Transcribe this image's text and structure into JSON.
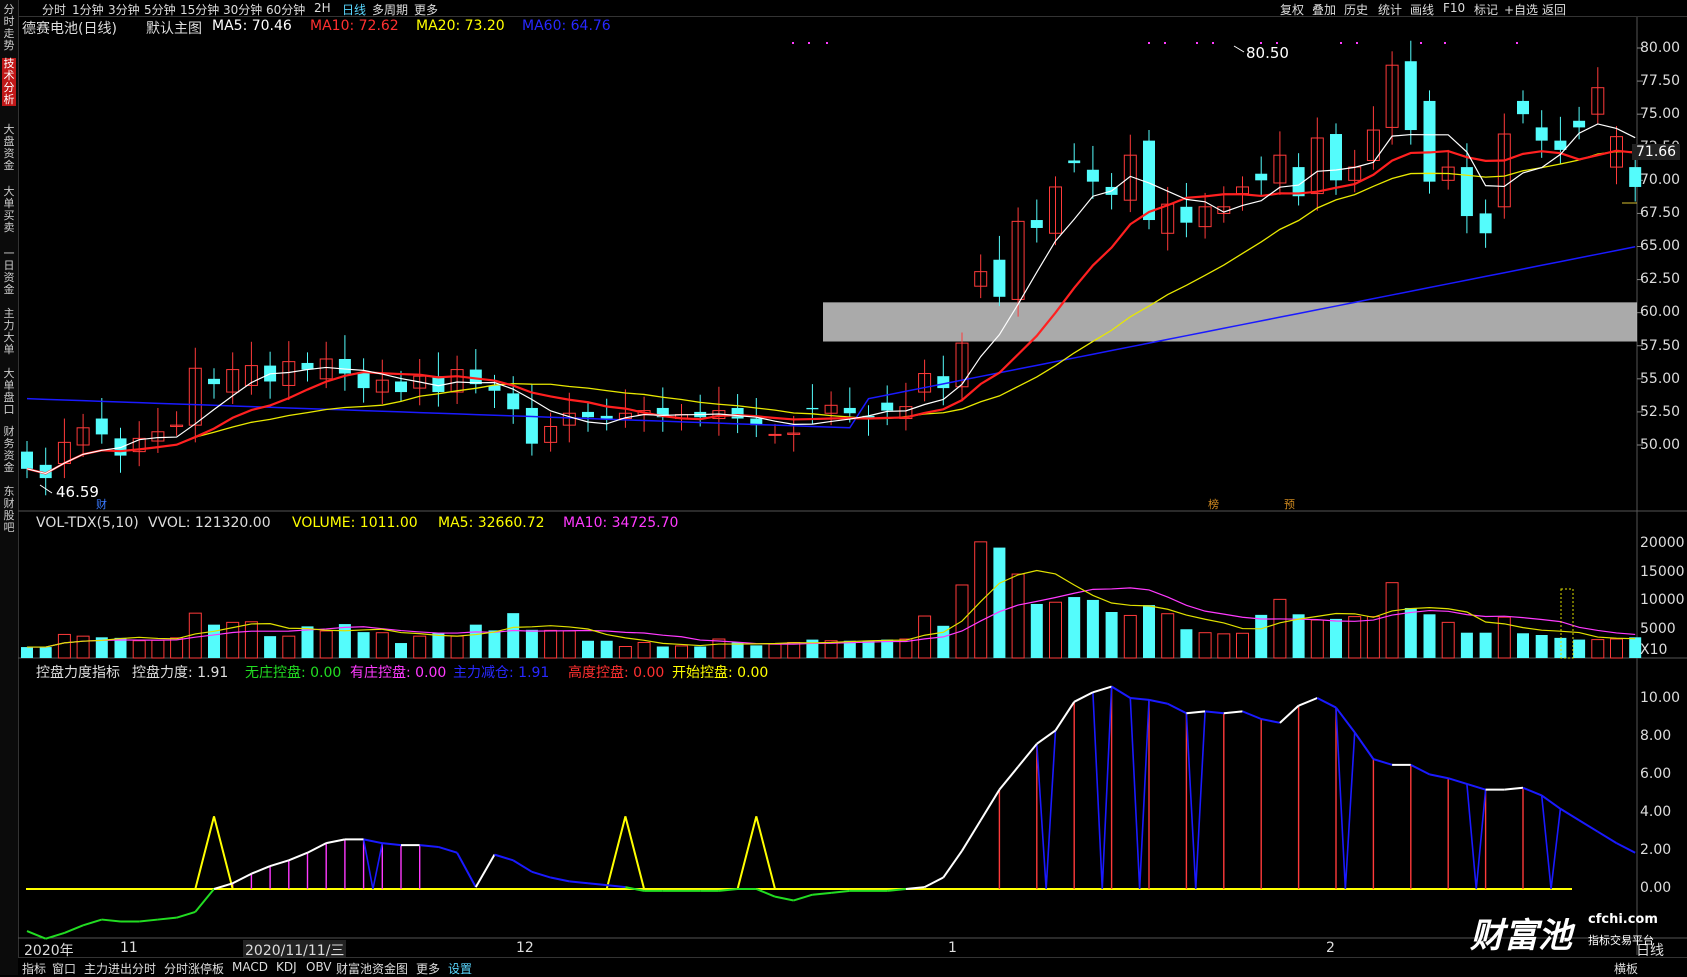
{
  "topbar": {
    "items": [
      "分时",
      "1分钟",
      "3分钟",
      "5分钟",
      "15分钟",
      "30分钟",
      "60分钟",
      "2H",
      "日线",
      "多周期",
      "更多"
    ],
    "active": "日线",
    "right": [
      "复权",
      "叠加",
      "历史",
      "统计",
      "画线",
      "F10",
      "标记",
      "+自选",
      "返回"
    ]
  },
  "sidebar": {
    "items": [
      "分时走势",
      "技术分析",
      "大盘资金",
      "大单买卖",
      "一日资金",
      "主力大单",
      "大单盘口",
      "财务资金",
      "东财股吧"
    ],
    "active": "技术分析"
  },
  "main": {
    "stock": "德赛电池(日线)",
    "template": "默认主图",
    "ma5": "MA5: 70.46",
    "ma10": "MA10: 72.62",
    "ma20": "MA20: 73.20",
    "ma60": "MA60: 64.76",
    "price_marker": "71.66",
    "high_label": "80.50",
    "low_label": "46.59",
    "zone_label": "57.82 - 60.78",
    "badges": [
      "财",
      "榜",
      "预"
    ],
    "yaxis": [
      "80.00",
      "77.50",
      "75.00",
      "72.50",
      "70.00",
      "67.50",
      "65.00",
      "62.50",
      "60.00",
      "57.50",
      "55.00",
      "52.50",
      "50.00"
    ]
  },
  "volume": {
    "name": "VOL-TDX(5,10)",
    "vvol": "VVOL: 121320.00",
    "volume": "VOLUME: 1011.00",
    "ma5": "MA5: 32660.72",
    "ma10": "MA10: 34725.70",
    "yaxis": [
      "20000",
      "15000",
      "10000",
      "5000",
      "X10"
    ]
  },
  "indicator": {
    "name": "控盘力度指标",
    "v1": "控盘力度: 1.91",
    "v2": "无庄控盘: 0.00",
    "v3": "有庄控盘: 0.00",
    "v4": "主力减仓: 1.91",
    "v5": "高度控盘: 0.00",
    "v6": "开始控盘: 0.00",
    "yaxis": [
      "10.00",
      "8.00",
      "6.00",
      "4.00",
      "2.00",
      "0.00"
    ]
  },
  "xaxis": {
    "labels": [
      "2020年",
      "11",
      "2020/11/11/三",
      "12",
      "1",
      "2"
    ],
    "right": "日线"
  },
  "bottombar": {
    "items": [
      "指标",
      "窗口",
      "主力进出分时",
      "分时涨停板",
      "MACD",
      "KDJ",
      "OBV",
      "财富池资金图",
      "更多",
      "设置"
    ],
    "right": "横板"
  },
  "watermark": {
    "brand": "财富池",
    "url": "cfchi.com",
    "slogan": "指标交易平台"
  },
  "colors": {
    "up": "#ff3a3a",
    "down": "#54fcfc",
    "ma5": "#ffffff",
    "ma10": "#ff2020",
    "ma20": "#e8e800",
    "ma60": "#1a1aff",
    "magenta": "#ff3aff",
    "yellow": "#ffff00",
    "green": "#22dd22"
  },
  "chart_data": [
    {
      "type": "candlestick",
      "title": "德赛电池(日线)",
      "ylim": [
        46,
        81
      ],
      "notes": "about 87 daily candles; high 80.50, low 46.59; shaded price zone 57.82 - 60.78",
      "high": 80.5,
      "low": 46.59,
      "zone": [
        57.82,
        60.78
      ],
      "last_close": 68.5
    },
    {
      "type": "bar",
      "title": "VOL-TDX(5,10)",
      "ylim": [
        0,
        22000
      ]
    },
    {
      "type": "line",
      "title": "控盘力度指标",
      "ylim": [
        -4,
        11.5
      ],
      "last_value": 1.91
    }
  ]
}
